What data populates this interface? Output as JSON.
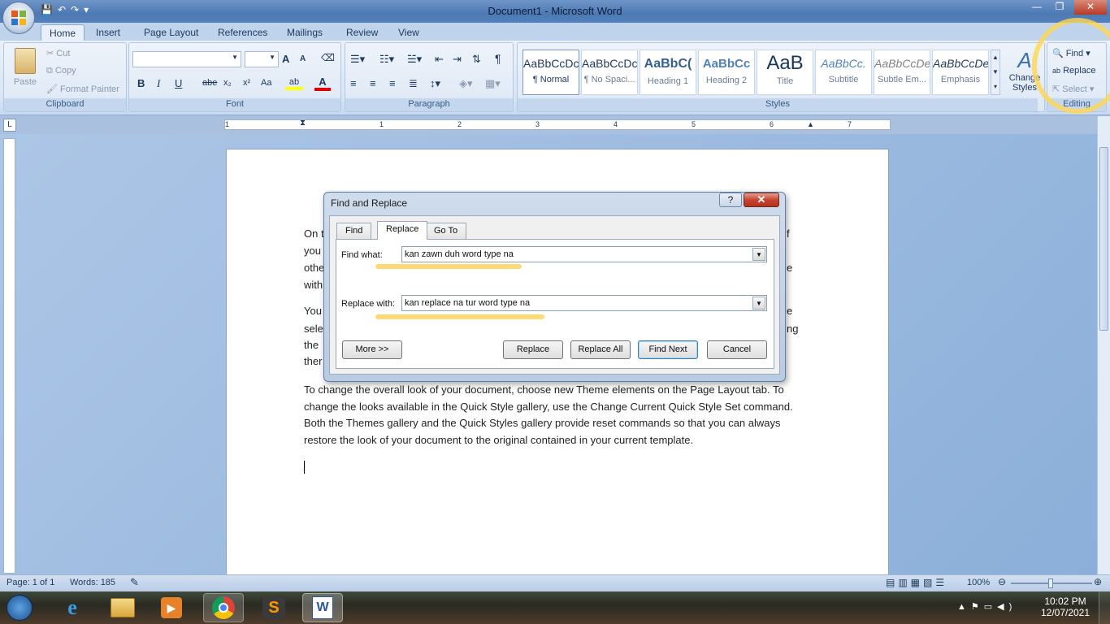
{
  "window": {
    "title": "Document1 - Microsoft Word",
    "qat_icons": [
      "save-icon",
      "undo-icon",
      "redo-icon",
      "customize-icon"
    ]
  },
  "tabs": [
    "Home",
    "Insert",
    "Page Layout",
    "References",
    "Mailings",
    "Review",
    "View"
  ],
  "clipboard": {
    "paste": "Paste",
    "cut": "Cut",
    "copy": "Copy",
    "format_painter": "Format Painter",
    "label": "Clipboard"
  },
  "font": {
    "label": "Font",
    "bold": "B",
    "italic": "I",
    "underline": "U",
    "strike": "abe",
    "sub": "x₂",
    "sup": "x²",
    "case": "Aa",
    "grow": "A",
    "shrink": "A"
  },
  "paragraph": {
    "label": "Paragraph"
  },
  "styles": {
    "label": "Styles",
    "items": [
      {
        "preview": "AaBbCcDc",
        "name": "¶ Normal"
      },
      {
        "preview": "AaBbCcDc",
        "name": "¶ No Spaci..."
      },
      {
        "preview": "AaBbC(",
        "name": "Heading 1"
      },
      {
        "preview": "AaBbCc",
        "name": "Heading 2"
      },
      {
        "preview": "AaB",
        "name": "Title"
      },
      {
        "preview": "AaBbCc.",
        "name": "Subtitle"
      },
      {
        "preview": "AaBbCcDe",
        "name": "Subtle Em..."
      },
      {
        "preview": "AaBbCcDe",
        "name": "Emphasis"
      }
    ],
    "change": "Change Styles"
  },
  "editing": {
    "find": "Find",
    "replace": "Replace",
    "select": "Select",
    "label": "Editing"
  },
  "ruler": {
    "marks": [
      "1",
      "1",
      "2",
      "3",
      "4",
      "5",
      "6",
      "7"
    ]
  },
  "document": {
    "partial_lines": [
      "On t",
      "you",
      "othe",
      "with",
      "You",
      "sele",
      "the",
      "ther"
    ],
    "partial_right": [
      "f",
      "e",
      "e",
      "ng"
    ],
    "paragraph": [
      "To change the overall look of your document, choose new Theme elements on the Page Layout tab. To",
      "change the looks available in the Quick Style gallery, use the Change Current Quick Style Set command.",
      "Both the Themes gallery and the Quick Styles gallery provide reset commands so that you can always",
      "restore the look of your document to the original contained in your current template."
    ]
  },
  "dialog": {
    "title": "Find and Replace",
    "help": "?",
    "close": "✕",
    "tabs": [
      "Find",
      "Replace",
      "Go To"
    ],
    "active_tab": "Replace",
    "find_label": "Find what:",
    "find_value": "kan zawn duh word type na",
    "replace_label": "Replace with:",
    "replace_value": "kan replace na tur word type na",
    "buttons": {
      "more": "More >>",
      "replace": "Replace",
      "replace_all": "Replace All",
      "find_next": "Find Next",
      "cancel": "Cancel"
    }
  },
  "status": {
    "page": "Page: 1 of 1",
    "words": "Words: 185",
    "zoom": "100%"
  },
  "taskbar": {
    "time": "10:02 PM",
    "date": "12/07/2021"
  }
}
